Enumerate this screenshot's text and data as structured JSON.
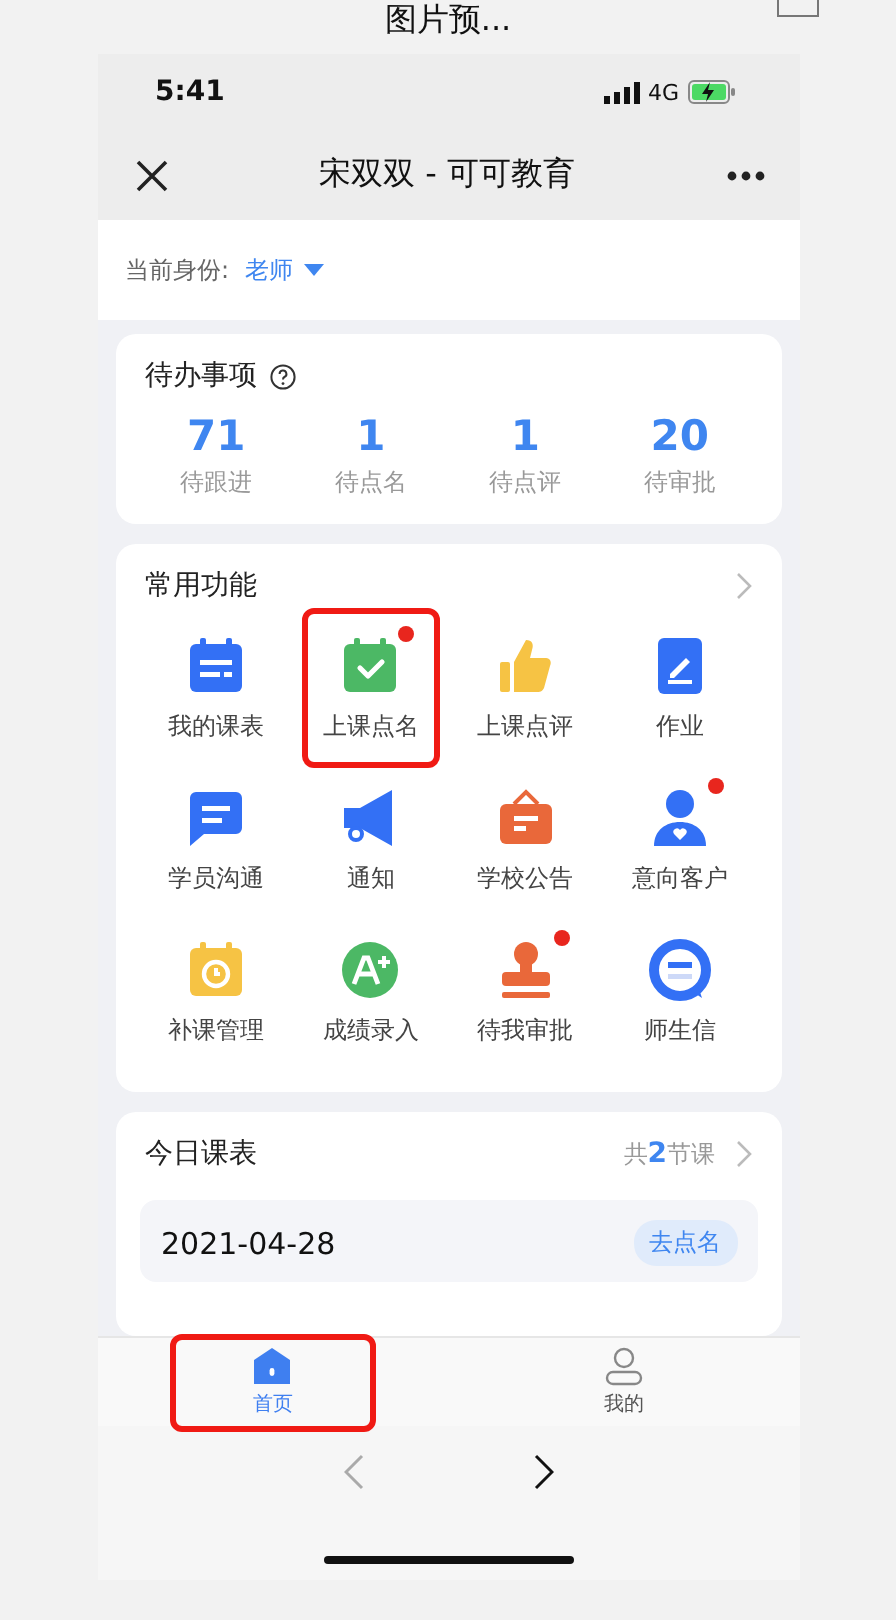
{
  "window_title": "图片预...",
  "status_bar": {
    "time": "5:41",
    "network": "4G"
  },
  "nav": {
    "title": "宋双双 - 可可教育"
  },
  "identity": {
    "label": "当前身份:",
    "value": "老师"
  },
  "todo": {
    "title": "待办事项",
    "stats": [
      {
        "value": "71",
        "label": "待跟进"
      },
      {
        "value": "1",
        "label": "待点名"
      },
      {
        "value": "1",
        "label": "待点评"
      },
      {
        "value": "20",
        "label": "待审批"
      }
    ]
  },
  "functions": {
    "title": "常用功能",
    "items": [
      {
        "label": "我的课表",
        "kind": "schedule",
        "badge": false,
        "highlighted": false
      },
      {
        "label": "上课点名",
        "kind": "checkin",
        "badge": true,
        "highlighted": true
      },
      {
        "label": "上课点评",
        "kind": "thumb",
        "badge": false,
        "highlighted": false
      },
      {
        "label": "作业",
        "kind": "homework",
        "badge": false,
        "highlighted": false
      },
      {
        "label": "学员沟通",
        "kind": "chat",
        "badge": false,
        "highlighted": false
      },
      {
        "label": "通知",
        "kind": "megaphone",
        "badge": false,
        "highlighted": false
      },
      {
        "label": "学校公告",
        "kind": "board",
        "badge": false,
        "highlighted": false
      },
      {
        "label": "意向客户",
        "kind": "person",
        "badge": true,
        "highlighted": false
      },
      {
        "label": "补课管理",
        "kind": "clock",
        "badge": false,
        "highlighted": false
      },
      {
        "label": "成绩录入",
        "kind": "grade",
        "badge": false,
        "highlighted": false
      },
      {
        "label": "待我审批",
        "kind": "stamp",
        "badge": true,
        "highlighted": false
      },
      {
        "label": "师生信",
        "kind": "message",
        "badge": false,
        "highlighted": false
      }
    ]
  },
  "schedule": {
    "title": "今日课表",
    "count": "共**2**节课",
    "lesson": {
      "date": "2021-04-28",
      "action": "去点名"
    }
  },
  "tabs": [
    {
      "label": "首页",
      "kind": "home",
      "selected": true,
      "highlighted": true
    },
    {
      "label": "我的",
      "kind": "user",
      "selected": false,
      "highlighted": false
    }
  ]
}
